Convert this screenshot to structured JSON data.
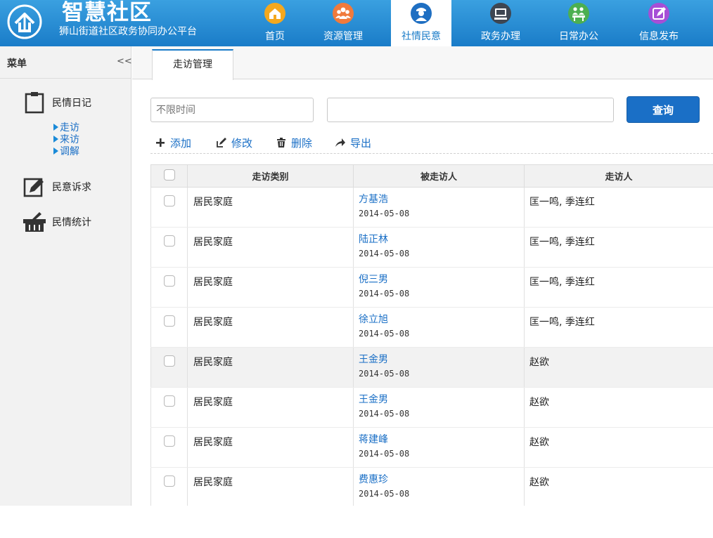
{
  "header": {
    "title": "智慧社区",
    "subtitle": "狮山街道社区政务协同办公平台",
    "nav": [
      {
        "label": "首页",
        "icon": "home-icon",
        "color": "#f4a81e"
      },
      {
        "label": "资源管理",
        "icon": "people-icon",
        "color": "#f07a3c"
      },
      {
        "label": "社情民意",
        "icon": "police-icon",
        "color": "#1f6fc2",
        "active": true
      },
      {
        "label": "政务办理",
        "icon": "monitor-icon",
        "color": "#3e4652"
      },
      {
        "label": "日常办公",
        "icon": "office-icon",
        "color": "#4caf50"
      },
      {
        "label": "信息发布",
        "icon": "edit-icon",
        "color": "#a64fd6"
      }
    ]
  },
  "sidebar": {
    "title": "菜单",
    "collapse": "<<",
    "groups": [
      {
        "label": "民情日记",
        "icon": "clipboard-icon",
        "items": [
          {
            "label": "走访"
          },
          {
            "label": "来访"
          },
          {
            "label": "调解"
          }
        ]
      },
      {
        "label": "民意诉求",
        "icon": "edit-icon"
      },
      {
        "label": "民情统计",
        "icon": "basket-icon"
      }
    ]
  },
  "main": {
    "tab": "走访管理",
    "filter": {
      "time_placeholder": "不限时间",
      "search_placeholder": ""
    },
    "query_label": "查询",
    "toolbar": {
      "add": "添加",
      "edit": "修改",
      "delete": "删除",
      "export": "导出"
    },
    "columns": [
      "走访类别",
      "被走访人",
      "走访人"
    ],
    "rows": [
      {
        "type": "居民家庭",
        "person": "方基浩",
        "date": "2014-05-08",
        "visitor": "匡一鸣, 季连红"
      },
      {
        "type": "居民家庭",
        "person": "陆正林",
        "date": "2014-05-08",
        "visitor": "匡一鸣, 季连红"
      },
      {
        "type": "居民家庭",
        "person": "倪三男",
        "date": "2014-05-08",
        "visitor": "匡一鸣, 季连红"
      },
      {
        "type": "居民家庭",
        "person": "徐立旭",
        "date": "2014-05-08",
        "visitor": "匡一鸣, 季连红"
      },
      {
        "type": "居民家庭",
        "person": "王金男",
        "date": "2014-05-08",
        "visitor": "赵欲",
        "highlighted": true
      },
      {
        "type": "居民家庭",
        "person": "王金男",
        "date": "2014-05-08",
        "visitor": "赵欲"
      },
      {
        "type": "居民家庭",
        "person": "蒋建峰",
        "date": "2014-05-08",
        "visitor": "赵欲"
      },
      {
        "type": "居民家庭",
        "person": "费惠珍",
        "date": "2014-05-08",
        "visitor": "赵欲"
      }
    ]
  }
}
